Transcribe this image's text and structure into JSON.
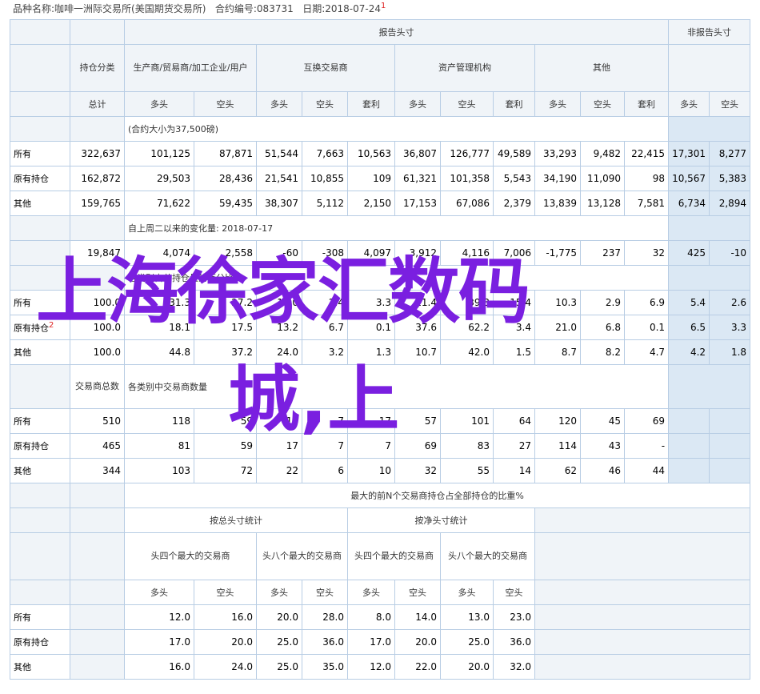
{
  "header": {
    "product_label": "品种名称:",
    "product": "咖啡一洲际交易所(美国期货交易所)",
    "code_label": "合约编号:",
    "code": "083731",
    "date_label": "日期:",
    "date": "2018-07-24",
    "marker": "1"
  },
  "s1": {
    "report_header": "报告头寸",
    "nonreport_header": "非报告头寸",
    "holding_class": "持仓分类",
    "producer": "生产商/贸易商/加工企业/用户",
    "swap": "互换交易商",
    "money": "资产管理机构",
    "other": "其他",
    "total": "总计",
    "long": "多头",
    "short": "空头",
    "spread": "套利",
    "unit_note": "(合约大小为37,500磅)",
    "rows": [
      {
        "label": "所有",
        "vals": [
          "322,637",
          "101,125",
          "87,871",
          "51,544",
          "7,663",
          "10,563",
          "36,807",
          "126,777",
          "49,589",
          "33,293",
          "9,482",
          "22,415",
          "17,301",
          "8,277"
        ]
      },
      {
        "label": "原有持仓",
        "vals": [
          "162,872",
          "29,503",
          "28,436",
          "21,541",
          "10,855",
          "109",
          "61,321",
          "101,358",
          "5,543",
          "34,190",
          "11,090",
          "98",
          "10,567",
          "5,383"
        ]
      },
      {
        "label": "其他",
        "vals": [
          "159,765",
          "71,622",
          "59,435",
          "38,307",
          "5,112",
          "2,150",
          "17,153",
          "67,086",
          "2,379",
          "13,839",
          "13,128",
          "7,581",
          "6,734",
          "2,894"
        ]
      }
    ]
  },
  "s2": {
    "change_note": "自上周二以来的变化量: 2018-07-17",
    "change_vals": [
      "19,847",
      "4,074",
      "2,558",
      "-60",
      "-308",
      "4,097",
      "3,912",
      "4,116",
      "7,006",
      "-1,775",
      "237",
      "32",
      "425",
      "-10"
    ],
    "pct_note": "各类别占总持仓量的百分比",
    "rows": [
      {
        "label": "所有",
        "vals": [
          "100.0",
          "31.3",
          "27.2",
          "16.0",
          "2.4",
          "3.3",
          "11.4",
          "39.3",
          "15.4",
          "10.3",
          "2.9",
          "6.9",
          "5.4",
          "2.6"
        ]
      },
      {
        "label": "原有持仓",
        "vals": [
          "100.0",
          "18.1",
          "17.5",
          "13.2",
          "6.7",
          "0.1",
          "37.6",
          "62.2",
          "3.4",
          "21.0",
          "6.8",
          "0.1",
          "6.5",
          "3.3"
        ]
      },
      {
        "label": "其他",
        "vals": [
          "100.0",
          "44.8",
          "37.2",
          "24.0",
          "3.2",
          "1.3",
          "10.7",
          "42.0",
          "1.5",
          "8.7",
          "8.2",
          "4.7",
          "4.2",
          "1.8"
        ]
      }
    ],
    "marker": "2"
  },
  "s3": {
    "trader_count": "交易商总数",
    "note": "各类别中交易商数量",
    "rows": [
      {
        "label": "所有",
        "vals": [
          "510",
          "118",
          "59",
          "18",
          "7",
          "17",
          "57",
          "101",
          "64",
          "120",
          "45",
          "69"
        ]
      },
      {
        "label": "原有持仓",
        "vals": [
          "465",
          "81",
          "59",
          "17",
          "7",
          "7",
          "69",
          "83",
          "27",
          "114",
          "43",
          "-"
        ]
      },
      {
        "label": "其他",
        "vals": [
          "344",
          "103",
          "72",
          "22",
          "6",
          "10",
          "32",
          "55",
          "14",
          "62",
          "46",
          "44"
        ]
      }
    ]
  },
  "s4": {
    "title": "最大的前N个交易商持仓占全部持仓的比重%",
    "gross": "按总头寸统计",
    "net": "按净头寸统计",
    "top4": "头四个最大的交易商",
    "top8": "头八个最大的交易商",
    "long": "多头",
    "short": "空头",
    "rows": [
      {
        "label": "所有",
        "vals": [
          "12.0",
          "16.0",
          "20.0",
          "28.0",
          "8.0",
          "14.0",
          "13.0",
          "23.0"
        ]
      },
      {
        "label": "原有持仓",
        "vals": [
          "17.0",
          "20.0",
          "25.0",
          "36.0",
          "17.0",
          "20.0",
          "25.0",
          "36.0"
        ]
      },
      {
        "label": "其他",
        "vals": [
          "16.0",
          "24.0",
          "25.0",
          "35.0",
          "12.0",
          "22.0",
          "20.0",
          "32.0"
        ]
      }
    ]
  },
  "watermark": {
    "line1": "上海徐家汇数码",
    "line2": "城,上",
    "color": "#7a1fe0"
  }
}
